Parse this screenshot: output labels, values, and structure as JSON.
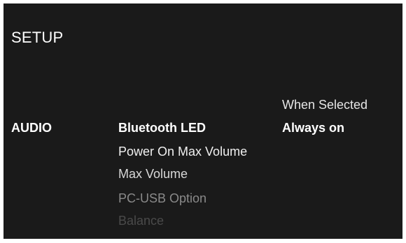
{
  "screen": {
    "title": "SETUP"
  },
  "category": {
    "label": "AUDIO"
  },
  "menu": {
    "items": [
      {
        "label": "Bluetooth LED",
        "state": "selected"
      },
      {
        "label": "Power On Max Volume",
        "state": "normal"
      },
      {
        "label": "Max Volume",
        "state": "normal"
      },
      {
        "label": "PC-USB Option",
        "state": "dimmed"
      },
      {
        "label": "Balance",
        "state": "faded"
      }
    ]
  },
  "value_panel": {
    "header": "When Selected",
    "value": "Always on"
  },
  "colors": {
    "background": "#1a1a1a",
    "text": "#ffffff",
    "dimmed": "#8a8a8a",
    "faded": "#4a4a4a"
  }
}
